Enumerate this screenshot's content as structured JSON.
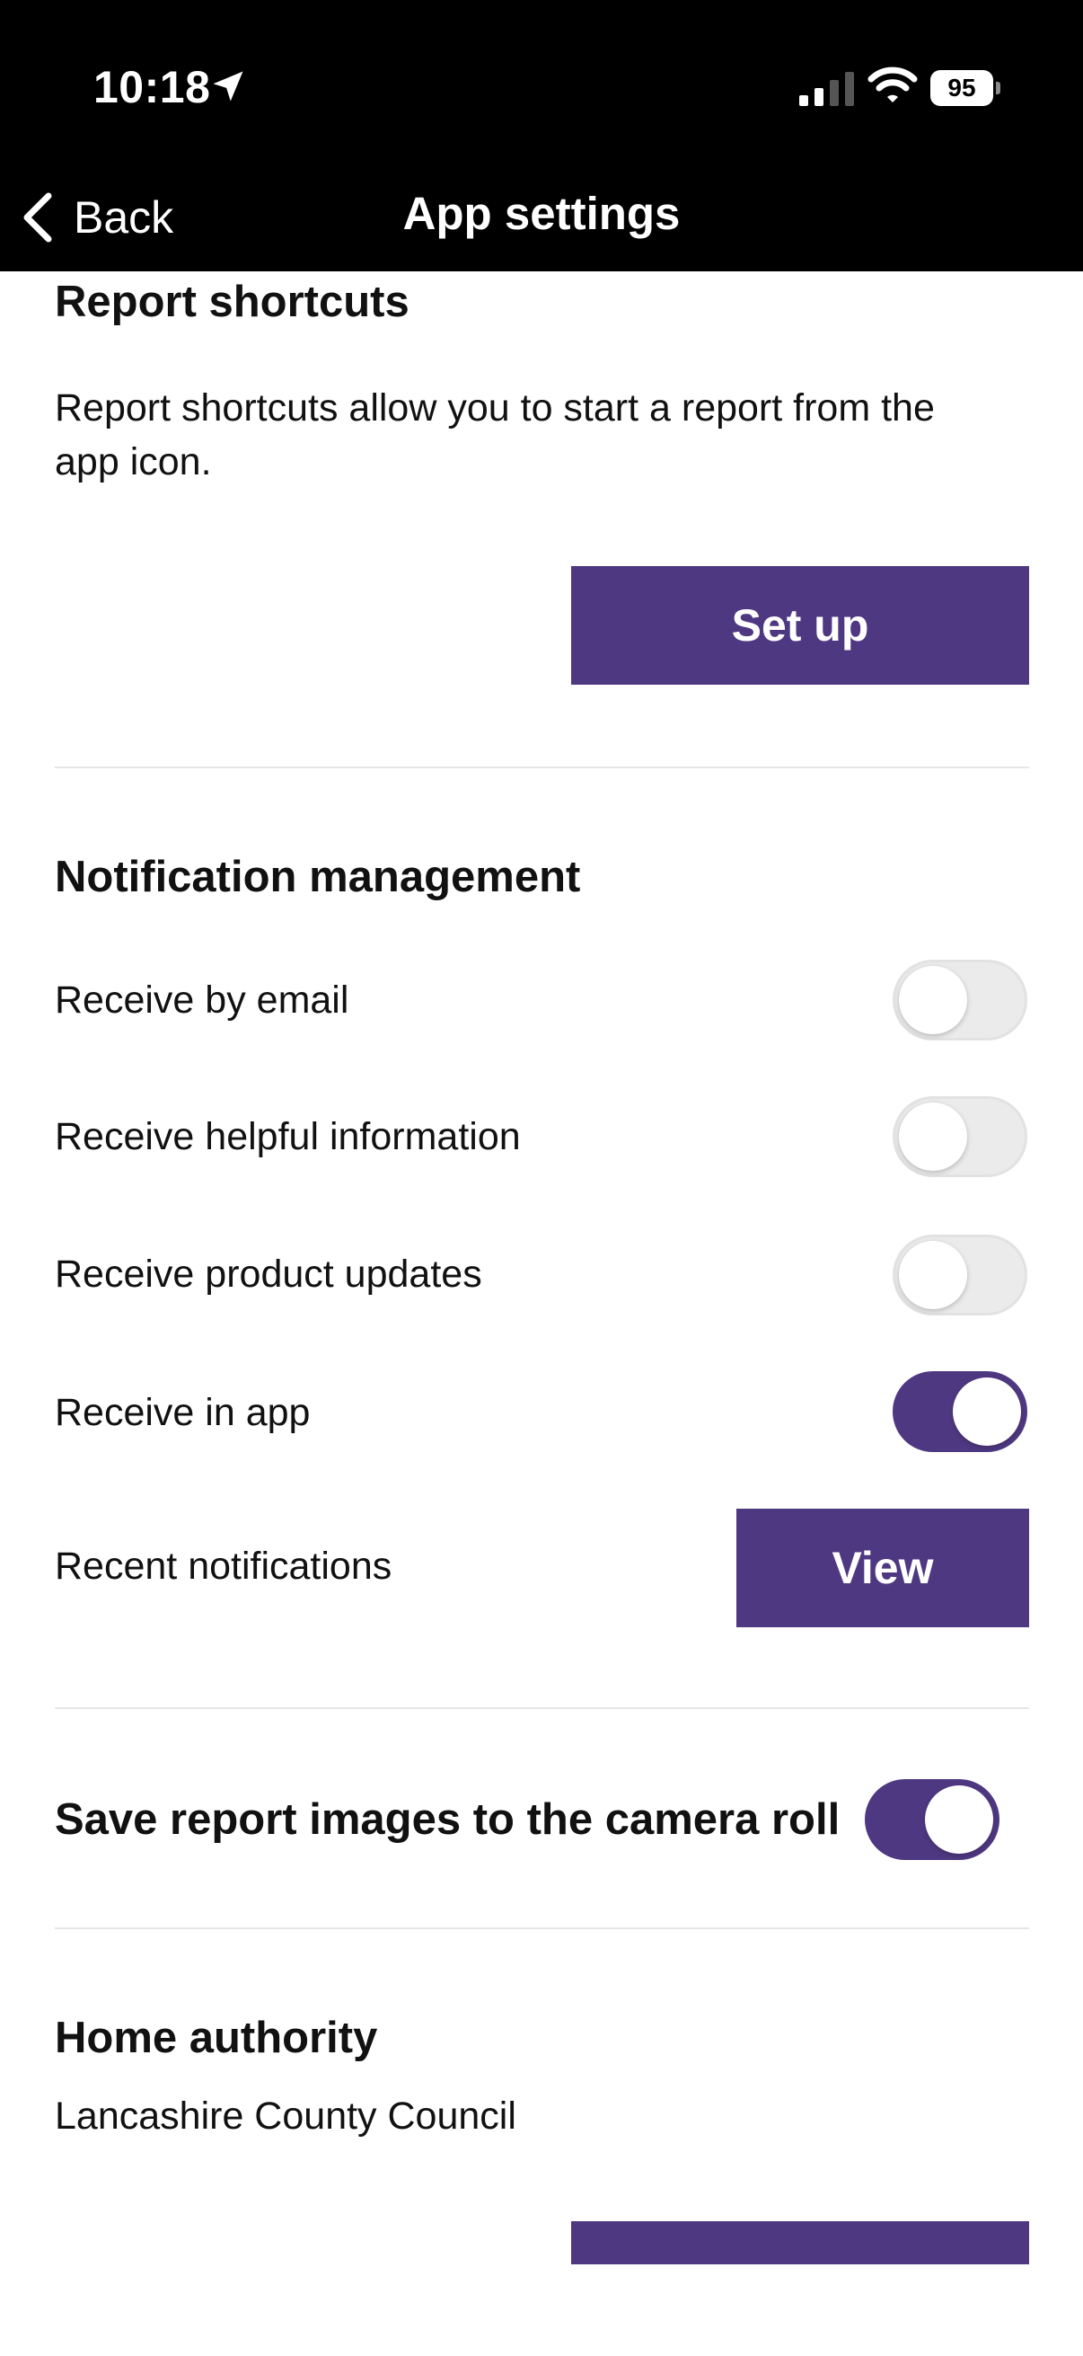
{
  "status_bar": {
    "time": "10:18",
    "battery_level": "95",
    "icons": [
      "location-arrow-icon",
      "cellular-signal-icon",
      "wifi-icon",
      "battery-icon"
    ]
  },
  "nav": {
    "back_label": "Back",
    "title": "App settings"
  },
  "report_shortcuts": {
    "heading": "Report shortcuts",
    "description_line1": "Report shortcuts allow you to start a report from the",
    "description_line2": "app icon.",
    "setup_label": "Set up"
  },
  "notifications": {
    "heading": "Notification management",
    "toggles": [
      {
        "label": "Receive by email",
        "on": false
      },
      {
        "label": "Receive helpful information",
        "on": false
      },
      {
        "label": "Receive product updates",
        "on": false
      },
      {
        "label": "Receive in app",
        "on": true
      }
    ],
    "recent_label": "Recent notifications",
    "view_label": "View"
  },
  "camera_roll": {
    "label": "Save report images to the camera roll",
    "on": true
  },
  "home_authority": {
    "heading": "Home authority",
    "value": "Lancashire County Council"
  },
  "colors": {
    "accent": "#4f3882",
    "toggle_off": "#ebebeb",
    "header_background": "#000000",
    "divider": "#e6e6e6"
  }
}
